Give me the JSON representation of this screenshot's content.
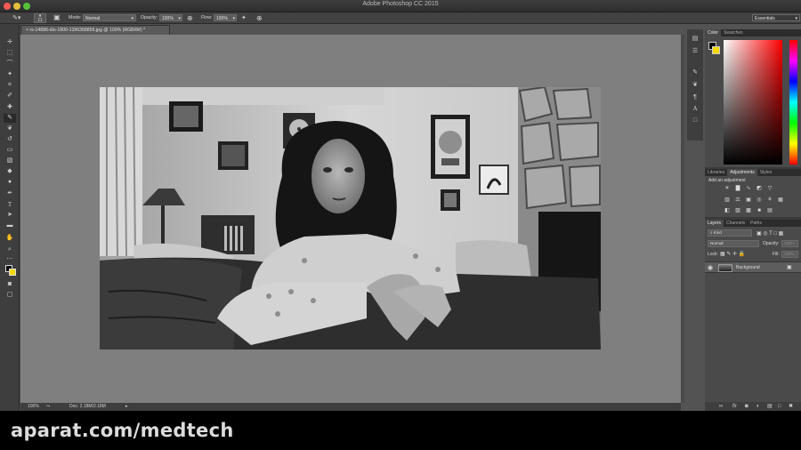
{
  "window": {
    "title": "Adobe Photoshop CC 2015"
  },
  "options_bar": {
    "brush_size": "11",
    "mode_label": "Mode:",
    "mode_value": "Normal",
    "opacity_label": "Opacity:",
    "opacity_value": "100%",
    "flow_label": "Flow:",
    "flow_value": "100%",
    "workspace": "Essentials"
  },
  "document": {
    "tab_title": "rs-14886-dio-1800-1396368856.jpg @ 100% (RGB/8#) *",
    "zoom": "100%",
    "doc_size": "Doc: 2.18M/2.18M"
  },
  "color_panel": {
    "tabs": [
      "Color",
      "Swatches"
    ],
    "active_tab": "Color",
    "fg": "#000000",
    "bg": "#f5d800",
    "hue": "#ff0000"
  },
  "adjustments_panel": {
    "tabs": [
      "Libraries",
      "Adjustments",
      "Styles"
    ],
    "active_tab": "Adjustments",
    "heading": "Add an adjustment"
  },
  "layers_panel": {
    "tabs": [
      "Layers",
      "Channels",
      "Paths"
    ],
    "active_tab": "Layers",
    "kind": "Kind",
    "blend_mode": "Normal",
    "opacity_label": "Opacity:",
    "opacity_value": "100%",
    "lock_label": "Lock:",
    "fill_label": "Fill:",
    "fill_value": "100%",
    "layers": [
      {
        "name": "Background",
        "visible": true,
        "locked": true
      }
    ]
  },
  "watermark": "aparat.com/medtech",
  "icons": {
    "tools": [
      "move-icon",
      "marquee-icon",
      "lasso-icon",
      "quick-select-icon",
      "crop-icon",
      "eyedropper-icon",
      "healing-icon",
      "brush-icon",
      "clone-stamp-icon",
      "history-brush-icon",
      "eraser-icon",
      "gradient-icon",
      "blur-icon",
      "dodge-icon",
      "pen-icon",
      "type-icon",
      "path-select-icon",
      "shape-icon",
      "hand-icon",
      "zoom-icon"
    ]
  }
}
